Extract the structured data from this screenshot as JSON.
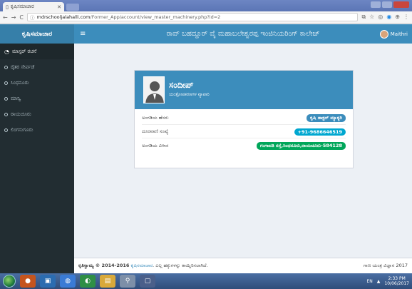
{
  "browser": {
    "tab_title": "ಕೃಷಿಸಮಾಚಾರ",
    "url_host": "mdrschooljalahalli.com",
    "url_path": "/Former_App/account/view_master_machinery.php?id=2"
  },
  "header": {
    "brand": "ಕೃಷಿಸಮಾಚಾರ",
    "college_title": "ರಾವ್ ಬಹದ್ದೂರ್ ವೈ ಮಹಾಬಲೇಶ್ವರಪ್ಪ ಇಂಜಿನಿಯರಿಂಗ್ ಕಾಲೇಜ್",
    "user_name": "Maithri"
  },
  "sidebar": {
    "items": [
      {
        "label": "ಮಾಸ್ಟರ್ ರಚನೆ"
      },
      {
        "label": "ರೈತರ ಸೇರ್ಪಡೆ"
      },
      {
        "label": "ಸಿಂಧನೂರು"
      },
      {
        "label": "ಮಾನ್ವಿ"
      },
      {
        "label": "ರಾಯಚೂರು"
      },
      {
        "label": "ಲಿಂಗಸುಗೂರು"
      }
    ]
  },
  "profile": {
    "name": "ಸಂದೀಪ್",
    "role": "ಯಂತ್ರೋಪಕರಣಗಳ ವ್ಯಾಪಾರಿ",
    "rows": [
      {
        "label": "ಅಂಗಡಿಯ ಹೆಸರು",
        "value": "ಕೃಷಿ ಡಾಕ್ಟರ್ ಮ್ಯಾಕ್ಯರಿ",
        "color": "blue"
      },
      {
        "label": "ದೂರವಾಣಿ ಸಂಖ್ಯೆ",
        "value": "+91-9686646519",
        "color": "cyan"
      },
      {
        "label": "ಅಂಗಡಿಯ ವಿಳಾಸ",
        "value": "ಗಂಗಾವತಿ ರಸ್ತೆ,ಸಿಂಧನೂರು,ರಾಯಚೂರು-584128",
        "color": "green"
      }
    ]
  },
  "footer": {
    "copyright_prefix": "ಕೃತಿಸ್ವಾಮ್ಯ © 2014-2016",
    "copyright_link": "ಕೃಷಿಸಮಾಚಾರ",
    "copyright_suffix": ". ಎಲ್ಲ ಹಕ್ಕುಗಳನ್ನು ಕಾಯ್ದಿರಿಸಲಾಗಿದೆ.",
    "right_text": "ಗಾಣ ಯಂತ್ರ ವಿಜ್ಞಾನ 2017"
  },
  "taskbar": {
    "lang": "EN",
    "time": "2:33 PM",
    "date": "10/06/2017"
  }
}
